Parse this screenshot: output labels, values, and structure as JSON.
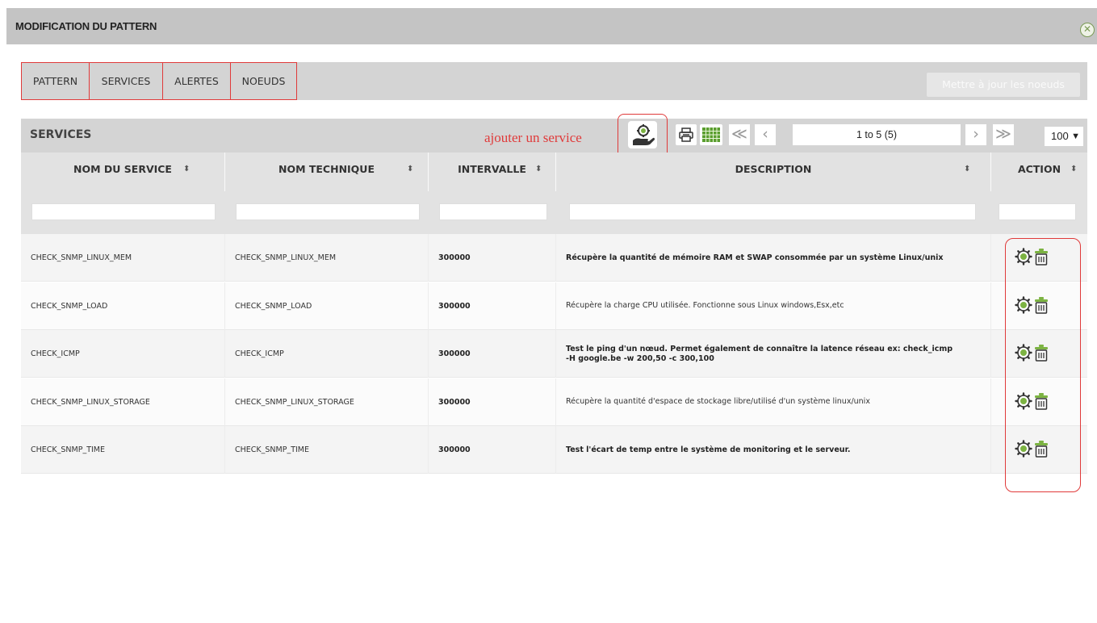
{
  "modal": {
    "title": "MODIFICATION DU PATTERN",
    "close_icon": "close-icon"
  },
  "tabs": [
    {
      "label": "PATTERN"
    },
    {
      "label": "SERVICES"
    },
    {
      "label": "ALERTES"
    },
    {
      "label": "NOEUDS"
    }
  ],
  "update_button": "Mettre à jour les noeuds",
  "grid": {
    "title": "SERVICES",
    "annotation": "ajouter un service",
    "toolbar": {
      "add_icon": "add-service-icon",
      "print_icon": "print-icon",
      "columns_icon": "columns-icon"
    },
    "pager": {
      "info": "1 to 5 (5)",
      "page_size": "100",
      "first": "≪",
      "prev": "‹",
      "next": "›",
      "last": "≫"
    },
    "columns": [
      {
        "label": "NOM DU SERVICE"
      },
      {
        "label": "NOM TECHNIQUE"
      },
      {
        "label": "INTERVALLE"
      },
      {
        "label": "DESCRIPTION"
      },
      {
        "label": "ACTION"
      }
    ],
    "rows": [
      {
        "name": "CHECK_SNMP_LINUX_MEM",
        "tech": "CHECK_SNMP_LINUX_MEM",
        "interval": "300000",
        "desc": "Récupère la quantité de mémoire RAM et SWAP consommée par un système Linux/unix",
        "bold_desc": true
      },
      {
        "name": "CHECK_SNMP_LOAD",
        "tech": "CHECK_SNMP_LOAD",
        "interval": "300000",
        "desc": "Récupère la charge CPU utilisée. Fonctionne sous Linux windows,Esx,etc",
        "bold_desc": false
      },
      {
        "name": "CHECK_ICMP",
        "tech": "CHECK_ICMP",
        "interval": "300000",
        "desc": "Test le ping d'un nœud. Permet également de connaître la latence réseau ex: check_icmp -H google.be -w 200,50 -c 300,100",
        "bold_desc": true
      },
      {
        "name": "CHECK_SNMP_LINUX_STORAGE",
        "tech": "CHECK_SNMP_LINUX_STORAGE",
        "interval": "300000",
        "desc": "Récupère la quantité d'espace de stockage libre/utilisé d'un système linux/unix",
        "bold_desc": false
      },
      {
        "name": "CHECK_SNMP_TIME",
        "tech": "CHECK_SNMP_TIME",
        "interval": "300000",
        "desc": "Test l'écart de temp entre le système de monitoring et le serveur.",
        "bold_desc": true
      }
    ],
    "action_icons": [
      "settings-gear-icon",
      "trash-icon"
    ]
  },
  "colors": {
    "header_bg": "#c4c4c4",
    "highlight": "#e03a3a",
    "icon_green": "#7cb342"
  }
}
